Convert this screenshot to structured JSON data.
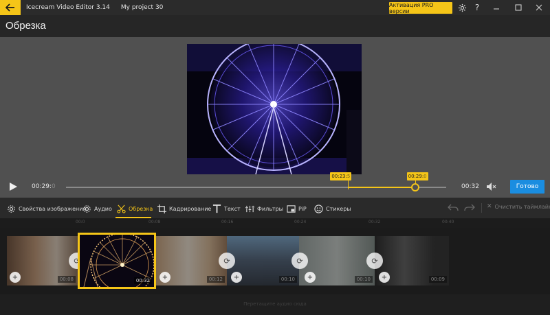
{
  "titlebar": {
    "app_name": "Icecream Video Editor 3.14",
    "project_name": "My project 30",
    "pro_button": "Активация PRO версии"
  },
  "header": {
    "title": "Обрезка"
  },
  "player": {
    "current_time_main": "00:29:",
    "current_time_frac": "0",
    "end_time": "00:32",
    "trim_start_main": "00:23:",
    "trim_start_frac": "5",
    "trim_end_main": "00:29:",
    "trim_end_frac": "0",
    "trim_start_fraction": 0.742,
    "trim_end_fraction": 0.918,
    "done_button": "Готово"
  },
  "toolbar": {
    "tools": [
      {
        "id": "image-props",
        "label": "Свойства изображения",
        "icon": "gear-icon"
      },
      {
        "id": "audio",
        "label": "Аудио",
        "icon": "gear-icon"
      },
      {
        "id": "trim",
        "label": "Обрезка",
        "icon": "scissors-icon"
      },
      {
        "id": "crop",
        "label": "Кадрирование",
        "icon": "crop-icon"
      },
      {
        "id": "text",
        "label": "Текст",
        "icon": "text-icon"
      },
      {
        "id": "filters",
        "label": "Фильтры",
        "icon": "filter-icon"
      },
      {
        "id": "pip",
        "label": "PiP",
        "icon": "pip-icon"
      },
      {
        "id": "stickers",
        "label": "Стикеры",
        "icon": "smiley-icon"
      }
    ],
    "active_tool": "trim",
    "clear_label": "Очистить таймлайн"
  },
  "timeline": {
    "ruler_ticks": [
      "00:0",
      "00:08",
      "00:16",
      "00:24",
      "00:32",
      "00:40"
    ],
    "clips": [
      {
        "duration": "00:08"
      },
      {
        "duration": "00:32"
      },
      {
        "duration": "00:12"
      },
      {
        "duration": "00:10"
      },
      {
        "duration": "00:10"
      },
      {
        "duration": "00:09"
      }
    ],
    "selected_clip_duration": "00:32",
    "audio_hint": "Перетащите аудио сюда"
  },
  "colors": {
    "accent": "#f5c518",
    "done": "#1a8de0"
  }
}
